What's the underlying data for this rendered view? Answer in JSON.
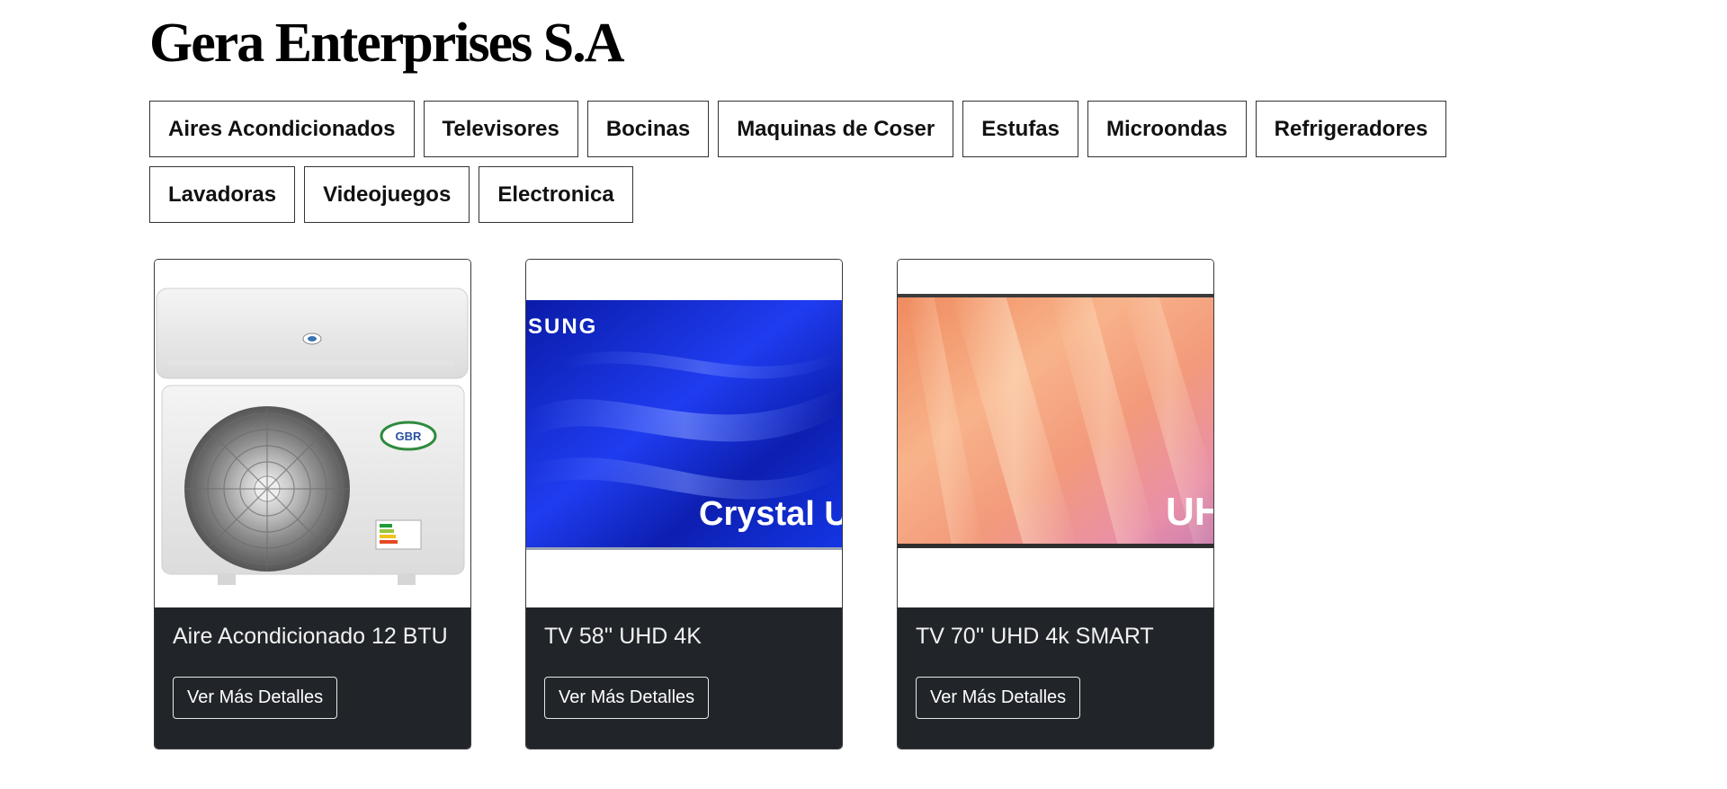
{
  "site": {
    "title": "Gera Enterprises S.A"
  },
  "nav": {
    "categories": [
      "Aires Acondicionados",
      "Televisores",
      "Bocinas",
      "Maquinas de Coser",
      "Estufas",
      "Microondas",
      "Refrigeradores",
      "Lavadoras",
      "Videojuegos",
      "Electronica"
    ]
  },
  "products": [
    {
      "title": "Aire Acondicionado 12 BTU",
      "button_label": "Ver Más Detalles",
      "image": "air-conditioner-image",
      "brand_badge": "GBR"
    },
    {
      "title": "TV 58'' UHD 4K",
      "button_label": "Ver Más Detalles",
      "image": "samsung-crystal-uhd-tv-image",
      "brand_text": "SUNG",
      "screen_text": "Crystal U"
    },
    {
      "title": "TV 70'' UHD 4k SMART",
      "button_label": "Ver Más Detalles",
      "image": "samsung-uhd-tv-image",
      "screen_text": "UH"
    }
  ],
  "colors": {
    "card_footer": "#212529",
    "page_background": "#ffffff",
    "tv_blue": "#1a2fd8",
    "tv_orange": "#f5a47a"
  }
}
